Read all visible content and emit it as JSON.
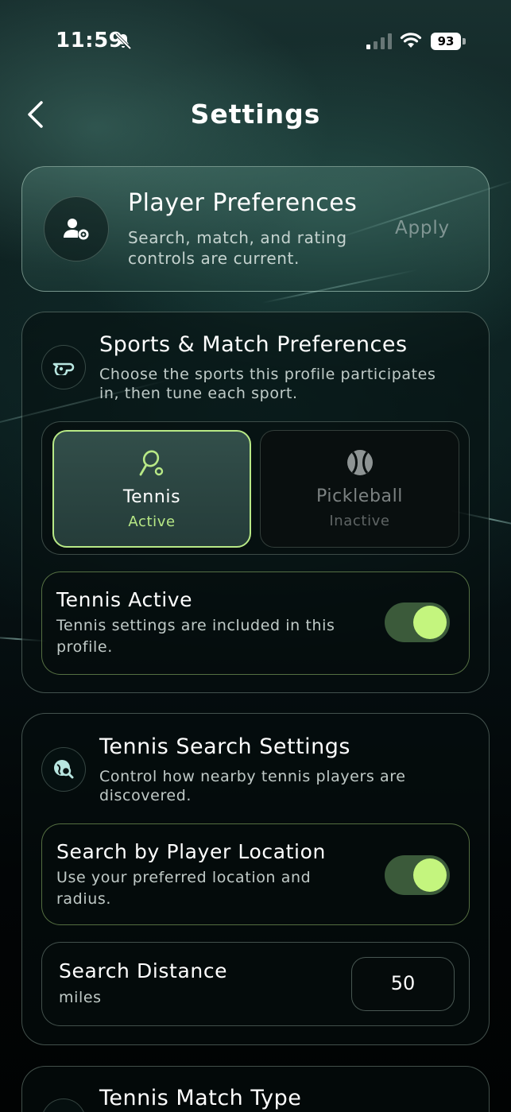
{
  "status_bar": {
    "time": "11:59",
    "battery": "93"
  },
  "header": {
    "title": "Settings"
  },
  "player_preferences": {
    "title": "Player Preferences",
    "subtitle_line1": "Search, match, and rating",
    "subtitle_line2": "controls are current.",
    "apply_label": "Apply"
  },
  "sports_match": {
    "title": "Sports & Match Preferences",
    "subtitle_line1": "Choose the sports this profile participates",
    "subtitle_line2": "in, then tune each sport.",
    "sports": [
      {
        "name": "Tennis",
        "state": "Active",
        "icon": "tennis-racket-icon"
      },
      {
        "name": "Pickleball",
        "state": "Inactive",
        "icon": "ball-icon"
      }
    ],
    "tennis_active": {
      "title": "Tennis Active",
      "subtitle_line1": "Tennis settings are included in this",
      "subtitle_line2": "profile.",
      "enabled": true
    }
  },
  "tennis_search": {
    "title": "Tennis Search Settings",
    "subtitle_line1": "Control how nearby tennis players are",
    "subtitle_line2": "discovered.",
    "location": {
      "title": "Search by Player Location",
      "subtitle_line1": "Use your preferred location and",
      "subtitle_line2": "radius.",
      "enabled": true
    },
    "distance": {
      "title": "Search Distance",
      "unit": "miles",
      "value": "50"
    }
  },
  "tennis_match_type": {
    "title": "Tennis Match Type"
  },
  "colors": {
    "accent": "#c4f57e",
    "toggle_track": "#3b5a3a"
  }
}
